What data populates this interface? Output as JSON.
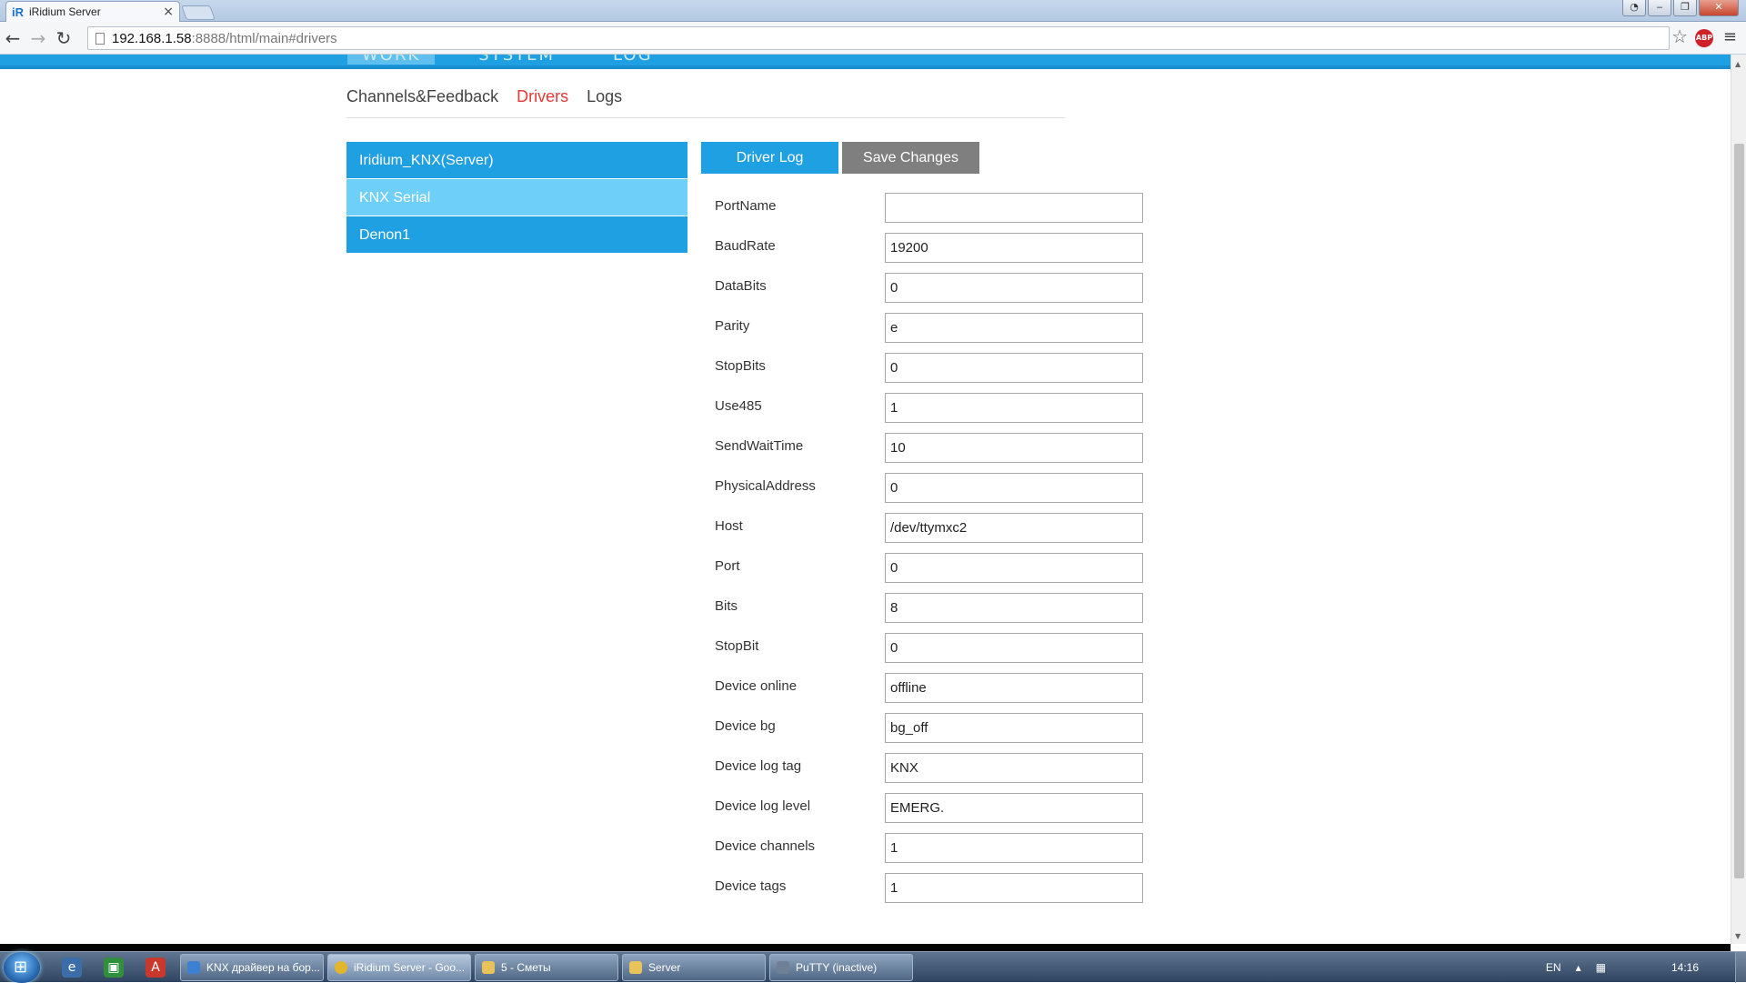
{
  "browser": {
    "tab_title": "iRidium Server",
    "tab_favicon": "iR",
    "url_host": "192.168.1.58",
    "url_path": ":8888/html/main#drivers"
  },
  "header": {
    "nav": [
      "WORK",
      "SYSTEM",
      "LOG"
    ]
  },
  "subnav": {
    "items": [
      {
        "label": "Channels&Feedback",
        "active": false
      },
      {
        "label": "Drivers",
        "active": true
      },
      {
        "label": "Logs",
        "active": false
      }
    ]
  },
  "drivers": [
    {
      "name": "Iridium_KNX(Server)",
      "selected": false
    },
    {
      "name": "KNX Serial",
      "selected": true
    },
    {
      "name": "Denon1",
      "selected": false
    }
  ],
  "actions": {
    "driver_log": "Driver Log",
    "save_changes": "Save Changes"
  },
  "fields": [
    {
      "label": "PortName",
      "value": ""
    },
    {
      "label": "BaudRate",
      "value": "19200"
    },
    {
      "label": "DataBits",
      "value": "0"
    },
    {
      "label": "Parity",
      "value": "e"
    },
    {
      "label": "StopBits",
      "value": "0"
    },
    {
      "label": "Use485",
      "value": "1"
    },
    {
      "label": "SendWaitTime",
      "value": "10"
    },
    {
      "label": "PhysicalAddress",
      "value": "0"
    },
    {
      "label": "Host",
      "value": "/dev/ttymxc2"
    },
    {
      "label": "Port",
      "value": "0"
    },
    {
      "label": "Bits",
      "value": "8"
    },
    {
      "label": "StopBit",
      "value": "0"
    },
    {
      "label": "Device online",
      "value": "offline"
    },
    {
      "label": "Device bg",
      "value": "bg_off"
    },
    {
      "label": "Device log tag",
      "value": "KNX"
    },
    {
      "label": "Device log level",
      "value": "EMERG."
    },
    {
      "label": "Device channels",
      "value": "1"
    },
    {
      "label": "Device tags",
      "value": "1"
    }
  ],
  "taskbar": {
    "tasks": [
      {
        "label": "KNX драйвер на бор...",
        "icon": "ie-icon",
        "active": false
      },
      {
        "label": "iRidium Server - Goo...",
        "icon": "chrome-icon",
        "active": true
      },
      {
        "label": "5 - Сметы",
        "icon": "folder-icon",
        "active": false
      },
      {
        "label": "Server",
        "icon": "folder-icon",
        "active": false
      },
      {
        "label": "PuTTY (inactive)",
        "icon": "putty-icon",
        "active": false
      }
    ],
    "lang": "EN",
    "time": "14:16"
  },
  "colors": {
    "accent": "#1ea0e3",
    "selected": "#6ecff8",
    "active_subnav": "#e53935",
    "save_button": "#7f7f7f"
  }
}
